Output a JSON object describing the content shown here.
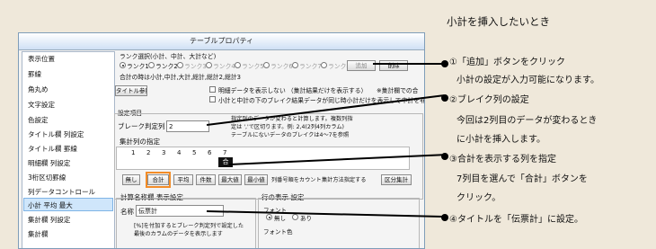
{
  "heading": "小計を挿入したいとき",
  "dialog": {
    "title": "テーブルプロパティ",
    "sidebar": [
      "表示位置",
      "罫線",
      "角丸め",
      "文字設定",
      "色設定",
      "タイトル欄 列設定",
      "タイトル欄 罫線",
      "明細欄 列設定",
      "3桁区切罫線",
      "列データコントロール",
      "小計 平均 最大",
      "集計欄 列設定",
      "集計欄"
    ],
    "rank": {
      "label": "ランク選択(小計、中計、大計など)",
      "options": [
        "ランク1",
        "ランク2",
        "ランク3",
        "ランク4",
        "ランク5",
        "ランク6",
        "ランク7",
        "ランク8"
      ],
      "add": "追加",
      "delete": "削除",
      "summary": "合計の時は小計,中計,大計,総計,総計2,総計3"
    },
    "title_ref_btn": "タイトル参照",
    "check1": "明細データを表示しない （集計結果だけを表示する）",
    "check1b": "※集計欄での合",
    "check2": "小計と中計の下のブレイク結果データが同じ時小計だけを表示して中計を非",
    "section": "設定項目",
    "break_label": "ブレーク判定列",
    "break_value": "2",
    "break_note": [
      "指定列のデータが変わると計算します。複数列指",
      "定は ','で区切ります。例: 2,4(2列4列カラム)",
      "テーブルにないデータのブレイクは4～7を参照"
    ],
    "subtotal_label": "集計列の指定",
    "columns": [
      "1",
      "2",
      "3",
      "4",
      "5",
      "6",
      "7"
    ],
    "col7_tag": "合",
    "func_buttons": [
      "無し",
      "合計",
      "平均",
      "件数",
      "最大値",
      "最小値",
      "列番号順をカウント",
      "集計方法指定する",
      "区分集計"
    ],
    "name_section": "計算名称欄 表示設定",
    "name_label": "名称",
    "name_value": "伝票計",
    "name_note": [
      "[%]を付加するとブレーク判定列で設定した",
      "最後のカラムのデータを表示します"
    ],
    "row_section": "行の表示 設定",
    "row_font": "フォント",
    "row_radio": [
      "無し",
      "あり"
    ],
    "row_font2": "フォント色"
  },
  "notes": {
    "n1": "①「追加」ボタンをクリック",
    "n1b": "小計の設定が入力可能になります。",
    "n2": "②ブレイク列の設定",
    "n2b": "今回は2列目のデータが変わるとき",
    "n2c": "に小計を挿入します。",
    "n3": "③合計を表示する列を指定",
    "n3b": "7列目を選んで「合計」ボタンを",
    "n3c": "クリック。",
    "n4": "④タイトルを「伝票計」に設定。"
  },
  "colors": {
    "background": "#efe8da",
    "highlight": "#f28c28",
    "selected_item": "#cfe6fb"
  }
}
